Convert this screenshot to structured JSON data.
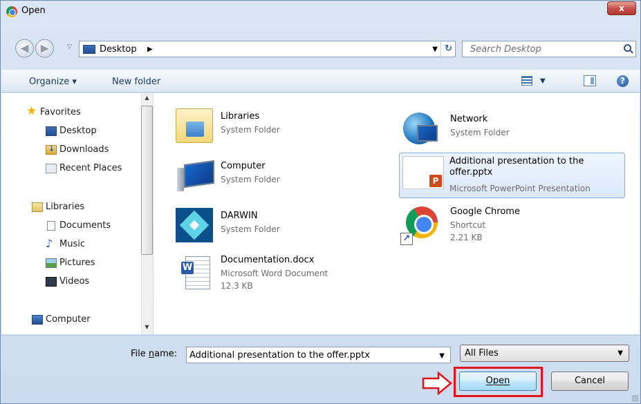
{
  "window": {
    "title": "Open",
    "close_label": "x"
  },
  "address": {
    "location": "Desktop",
    "search_placeholder": "Search Desktop"
  },
  "toolbar": {
    "organize_label": "Organize ▾",
    "new_folder_label": "New folder"
  },
  "nav": {
    "favorites_label": "Favorites",
    "favorites": [
      "Desktop",
      "Downloads",
      "Recent Places"
    ],
    "libraries_label": "Libraries",
    "libraries": [
      "Documents",
      "Music",
      "Pictures",
      "Videos"
    ],
    "computer_label": "Computer"
  },
  "items": [
    {
      "name": "Libraries",
      "line1": "System Folder",
      "line2": "",
      "icon": "library-folder-icon"
    },
    {
      "name": "Network",
      "line1": "System Folder",
      "line2": "",
      "icon": "network-globe-icon"
    },
    {
      "name": "Computer",
      "line1": "System Folder",
      "line2": "",
      "icon": "computer-icon"
    },
    {
      "name": "Additional presentation to the offer.pptx",
      "line1": "Microsoft PowerPoint Presentation",
      "line2": "",
      "icon": "powerpoint-file-icon",
      "selected": true
    },
    {
      "name": "DARWIN",
      "line1": "System Folder",
      "line2": "",
      "icon": "darwin-icon"
    },
    {
      "name": "Google Chrome",
      "line1": "Shortcut",
      "line2": "2.21 KB",
      "icon": "chrome-icon"
    },
    {
      "name": "Documentation.docx",
      "line1": "Microsoft Word Document",
      "line2": "12.3 KB",
      "icon": "word-file-icon"
    }
  ],
  "footer": {
    "file_name_label_pre": "File ",
    "file_name_label_u": "n",
    "file_name_label_post": "ame:",
    "file_name_value": "Additional presentation to the offer.pptx",
    "filter_value": "All Files",
    "open_label": "Open",
    "cancel_label": "Cancel"
  },
  "colors": {
    "selection": "#dbe9fb",
    "highlight_annotation": "#e1141b"
  }
}
